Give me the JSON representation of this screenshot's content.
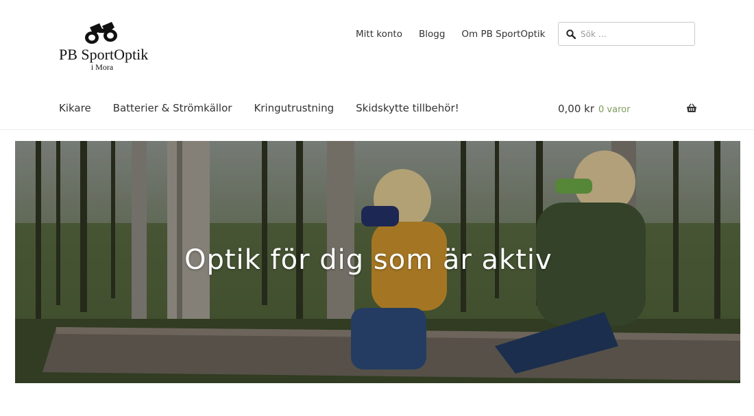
{
  "brand": {
    "name": "PB SportOptik",
    "subtitle": "i Mora"
  },
  "secondary_nav": [
    "Mitt konto",
    "Blogg",
    "Om PB SportOptik"
  ],
  "search": {
    "placeholder": "Sök …",
    "value": ""
  },
  "primary_nav": [
    "Kikare",
    "Batterier & Strömkällor",
    "Kringutrustning",
    "Skidskytte tillbehör!"
  ],
  "cart": {
    "amount": "0,00 kr",
    "count": "0 varor"
  },
  "hero": {
    "title": "Optik för dig som är aktiv"
  },
  "colors": {
    "accent_green": "#7d9a5c",
    "text": "#333333"
  }
}
